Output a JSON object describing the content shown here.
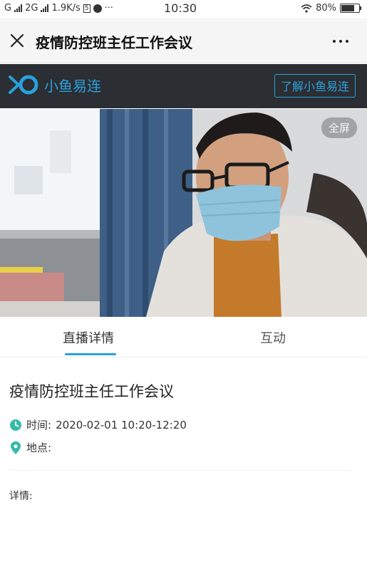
{
  "status_bar": {
    "carrier": "G",
    "network": "2G",
    "speed": "1.9K/s",
    "time": "10:30",
    "battery": "80%",
    "battery_level": 0.8
  },
  "header": {
    "title": "疫情防控班主任工作会议"
  },
  "brand": {
    "name": "小鱼易连",
    "learn_button": "了解小鱼易连",
    "accent_color": "#2aa0dd"
  },
  "video": {
    "fullscreen_label": "全屏"
  },
  "tabs": [
    {
      "label": "直播详情",
      "active": true
    },
    {
      "label": "互动",
      "active": false
    }
  ],
  "details": {
    "title": "疫情防控班主任工作会议",
    "time_label": "时间:",
    "time_value": "2020-02-01 10:20-12:20",
    "location_label": "地点:",
    "detail_label": "详情:"
  }
}
